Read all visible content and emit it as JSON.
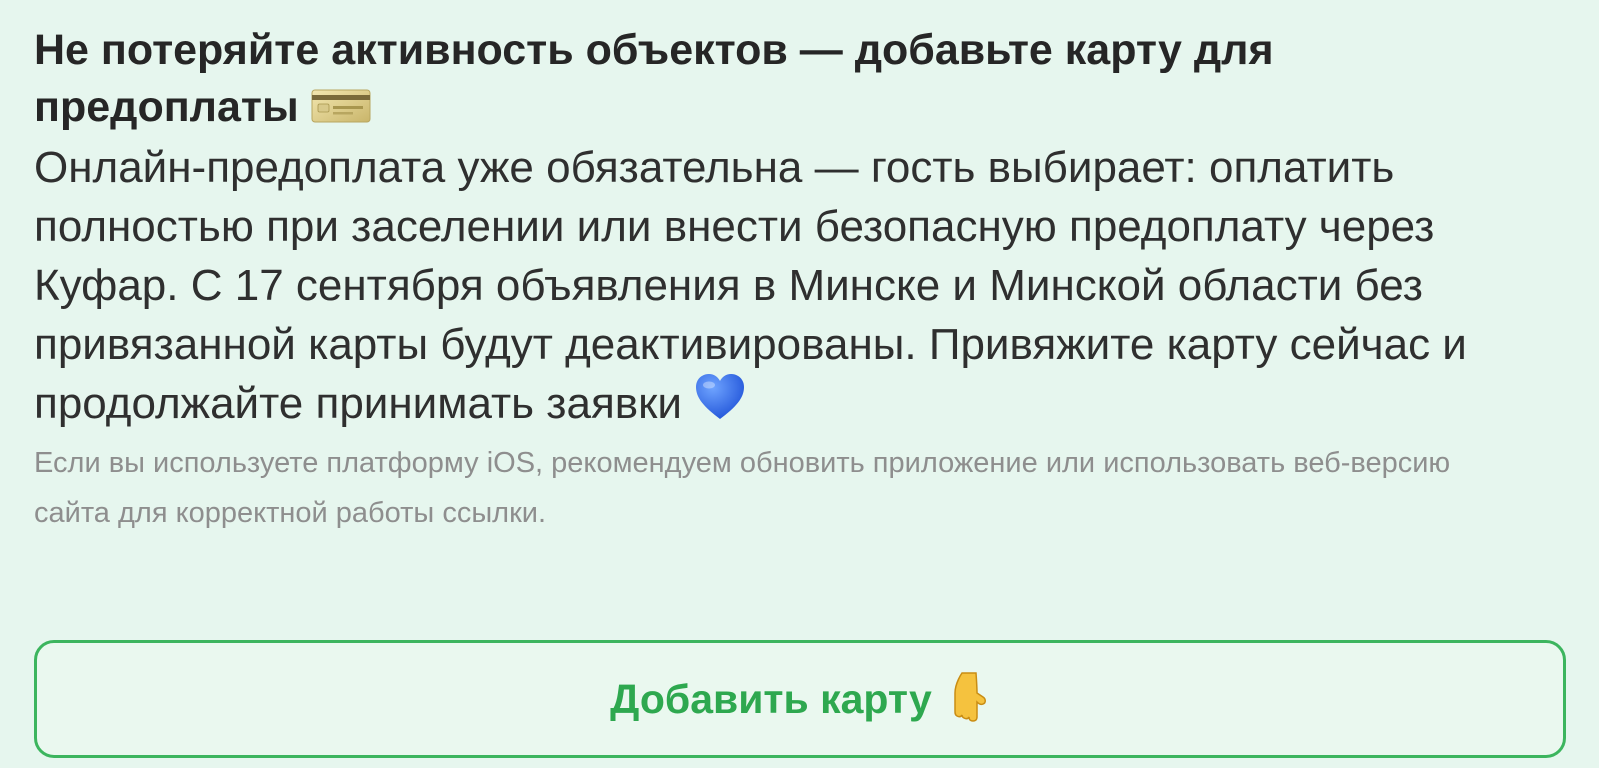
{
  "banner": {
    "title": "Не потеряйте активность объектов — добавьте карту для предоплаты",
    "title_icon": "credit-card-icon",
    "body": "Онлайн-предоплата уже обязательна — гость выбирает: оплатить полностью при заселении или внести безопасную предоплату через Куфар. С 17 сентября объявления в Минске и Минской области без привязанной карты будут деактивированы. Привяжите карту сейчас и продолжайте принимать заявки",
    "body_icon": "blue-heart-icon",
    "note": "Если вы используете платформу iOS, рекомендуем обновить приложение или использовать веб-версию сайта для корректной работы ссылки.",
    "button_label": "Добавить карту",
    "button_icon": "pointing-down-hand-icon"
  },
  "colors": {
    "background": "#e6f6ee",
    "accent": "#3cb55e",
    "button_text": "#2ea84f",
    "note_text": "#8e8e8e"
  }
}
